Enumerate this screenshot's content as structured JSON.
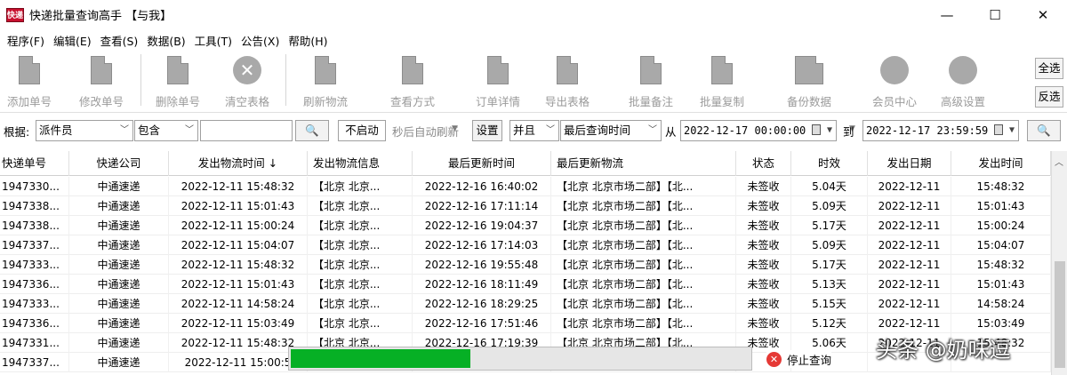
{
  "window": {
    "title": "快递批量查询高手 【与我】",
    "icon_text": "快递",
    "controls": [
      "—",
      "☐",
      "✕"
    ]
  },
  "menu": [
    "程序(F)",
    "编辑(E)",
    "查看(S)",
    "数据(B)",
    "工具(T)",
    "公告(X)",
    "帮助(H)"
  ],
  "toolbar": {
    "buttons": [
      {
        "label": "添加单号",
        "icon": "document-icon"
      },
      {
        "label": "修改单号",
        "icon": "edit-document-icon"
      },
      {
        "label": "删除单号",
        "icon": "delete-document-icon"
      },
      {
        "label": "清空表格",
        "icon": "clear-circle-icon"
      },
      {
        "label": "刷新物流",
        "icon": "refresh-document-icon"
      },
      {
        "label": "查看方式",
        "icon": "view-document-icon"
      },
      {
        "label": "订单详情",
        "icon": "order-detail-icon"
      },
      {
        "label": "导出表格",
        "icon": "export-table-icon"
      },
      {
        "label": "批量备注",
        "icon": "batch-note-icon"
      },
      {
        "label": "批量复制",
        "icon": "batch-copy-icon"
      },
      {
        "label": "备份数据",
        "icon": "backup-icon"
      },
      {
        "label": "会员中心",
        "icon": "clock-member-icon"
      },
      {
        "label": "高级设置",
        "icon": "gear-icon"
      }
    ],
    "select_all": "全选",
    "invert_select": "反选",
    "dropdown_glyph": "▼"
  },
  "filter": {
    "by_label": "根据:",
    "field": "派件员",
    "op": "包含",
    "value": "",
    "search_glyph": "🔍",
    "auto_refresh_toggle": "不启动",
    "auto_refresh_text": "秒后自动刷新",
    "settings": "设置",
    "logic": "并且",
    "time_field": "最后查询时间",
    "from_label": "从",
    "start": "2022-12-17 00:00:00",
    "to_label": "到",
    "end": "2022-12-17 23:59:59"
  },
  "table": {
    "columns": [
      "快递单号",
      "快递公司",
      "发出物流时间 ↓",
      "发出物流信息",
      "最后更新时间",
      "最后更新物流",
      "状态",
      "时效",
      "发出日期",
      "发出时间"
    ],
    "rows": [
      [
        "1947330...",
        "中通速递",
        "2022-12-11 15:48:32",
        "【北京 北京...",
        "2022-12-16 16:40:02",
        "【北京 北京市场二部】【北...",
        "未签收",
        "5.04天",
        "2022-12-11",
        "15:48:32"
      ],
      [
        "1947338...",
        "中通速递",
        "2022-12-11 15:01:43",
        "【北京 北京...",
        "2022-12-16 17:11:14",
        "【北京 北京市场二部】【北...",
        "未签收",
        "5.09天",
        "2022-12-11",
        "15:01:43"
      ],
      [
        "1947338...",
        "中通速递",
        "2022-12-11 15:00:24",
        "【北京 北京...",
        "2022-12-16 19:04:37",
        "【北京 北京市场二部】【北...",
        "未签收",
        "5.17天",
        "2022-12-11",
        "15:00:24"
      ],
      [
        "1947337...",
        "中通速递",
        "2022-12-11 15:04:07",
        "【北京 北京...",
        "2022-12-16 17:14:03",
        "【北京 北京市场二部】【北...",
        "未签收",
        "5.09天",
        "2022-12-11",
        "15:04:07"
      ],
      [
        "1947333...",
        "中通速递",
        "2022-12-11 15:48:32",
        "【北京 北京...",
        "2022-12-16 19:55:48",
        "【北京 北京市场二部】【北...",
        "未签收",
        "5.17天",
        "2022-12-11",
        "15:48:32"
      ],
      [
        "1947336...",
        "中通速递",
        "2022-12-11 15:01:43",
        "【北京 北京...",
        "2022-12-16 18:11:49",
        "【北京 北京市场二部】【北...",
        "未签收",
        "5.13天",
        "2022-12-11",
        "15:01:43"
      ],
      [
        "1947333...",
        "中通速递",
        "2022-12-11 14:58:24",
        "【北京 北京...",
        "2022-12-16 18:29:25",
        "【北京 北京市场二部】【北...",
        "未签收",
        "5.15天",
        "2022-12-11",
        "14:58:24"
      ],
      [
        "1947336...",
        "中通速递",
        "2022-12-11 15:03:49",
        "【北京 北京...",
        "2022-12-16 17:51:46",
        "【北京 北京市场二部】【北...",
        "未签收",
        "5.12天",
        "2022-12-11",
        "15:03:49"
      ],
      [
        "1947331...",
        "中通速递",
        "2022-12-11 15:48:32",
        "【北京 北京...",
        "2022-12-16 17:19:39",
        "【北京 北京市场二部】【北...",
        "未签收",
        "5.06天",
        "2022-12-11",
        "15:48:32"
      ],
      [
        "1947337...",
        "中通速递",
        "2022-12-11 15:00:5",
        "",
        "",
        "",
        "",
        "",
        "",
        ""
      ]
    ]
  },
  "progress": {
    "fraction": 0.39,
    "stop_label": "停止查询",
    "stop_glyph": "✕"
  },
  "watermark": "头条 @奶味逗"
}
